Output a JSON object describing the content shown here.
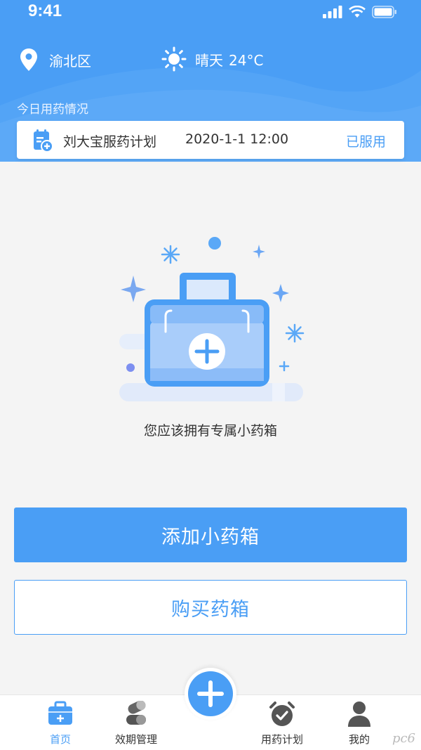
{
  "status_bar": {
    "time": "9:41"
  },
  "header": {
    "location": "渝北区",
    "weather": {
      "condition": "晴天",
      "temperature": "24°C"
    },
    "section_label": "今日用药情况"
  },
  "plan_card": {
    "name": "刘大宝服药计划",
    "time": "2020-1-1 12:00",
    "status": "已服用"
  },
  "empty_state": {
    "message": "您应该拥有专属小药箱"
  },
  "buttons": {
    "add": "添加小药箱",
    "buy": "购买药箱"
  },
  "tabbar": {
    "tabs": [
      {
        "label": "首页",
        "icon": "medicine-box-icon",
        "active": true
      },
      {
        "label": "效期管理",
        "icon": "pills-icon",
        "active": false
      },
      {
        "label": "用药计划",
        "icon": "alarm-clock-icon",
        "active": false
      },
      {
        "label": "我的",
        "icon": "user-icon",
        "active": false
      }
    ],
    "center_button_icon": "plus-icon"
  },
  "watermark": "pc6",
  "colors": {
    "primary": "#4a9ef5",
    "background": "#f4f4f4"
  }
}
